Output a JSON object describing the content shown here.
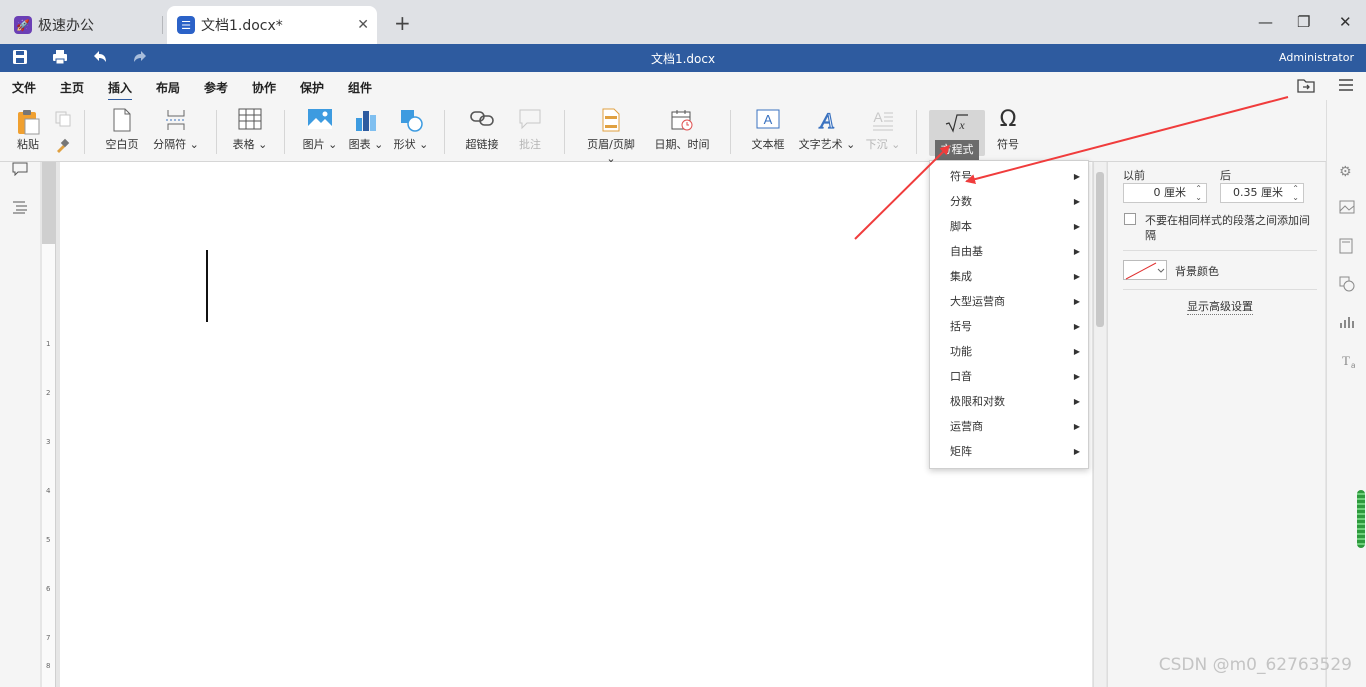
{
  "tabs": {
    "app_label": "极速办公",
    "doc_label": "文档1.docx*",
    "close_glyph": "✕",
    "new_tab_glyph": "+"
  },
  "window": {
    "minimize_glyph": "—",
    "restore_glyph": "❐",
    "close_glyph": "✕"
  },
  "titlebar": {
    "title": "文档1.docx",
    "user": "Administrator",
    "save_icon": "save-icon",
    "print_icon": "print-icon",
    "undo_icon": "undo-icon",
    "redo_icon": "redo-icon",
    "color": "#2e5b9f"
  },
  "menu": {
    "items": [
      "文件",
      "主页",
      "插入",
      "布局",
      "参考",
      "协作",
      "保护",
      "组件"
    ],
    "active": "插入"
  },
  "ribbon": {
    "paste": "粘贴",
    "blank_page": "空白页",
    "separator": "分隔符",
    "table": "表格",
    "picture": "图片",
    "chart": "图表",
    "shape": "形状",
    "hyperlink": "超链接",
    "comment": "批注",
    "header_footer": "页眉/页脚",
    "date_time": "日期、时间",
    "textbox": "文本框",
    "wordart": "文字艺术",
    "dropcap": "下沉",
    "equation": "方程式",
    "symbol": "符号"
  },
  "equation_menu": {
    "items": [
      "符号",
      "分数",
      "脚本",
      "自由基",
      "集成",
      "大型运营商",
      "括号",
      "功能",
      "口音",
      "极限和对数",
      "运营商",
      "矩阵"
    ]
  },
  "right_panel": {
    "before_label": "以前",
    "after_label": "后",
    "before_value": "0 厘米",
    "after_value": "0.35 厘米",
    "no_space_label_1": "不要在相同样式的段落之间添加间",
    "no_space_label_2": "隔",
    "bg_color_label": "背景颜色",
    "advanced_link": "显示高级设置"
  },
  "ruler": {
    "ticks": [
      "1",
      "2",
      "3",
      "4",
      "5",
      "6",
      "7",
      "8"
    ]
  },
  "watermark": "CSDN @m0_62763529",
  "annotation_color": "#f03c3c"
}
